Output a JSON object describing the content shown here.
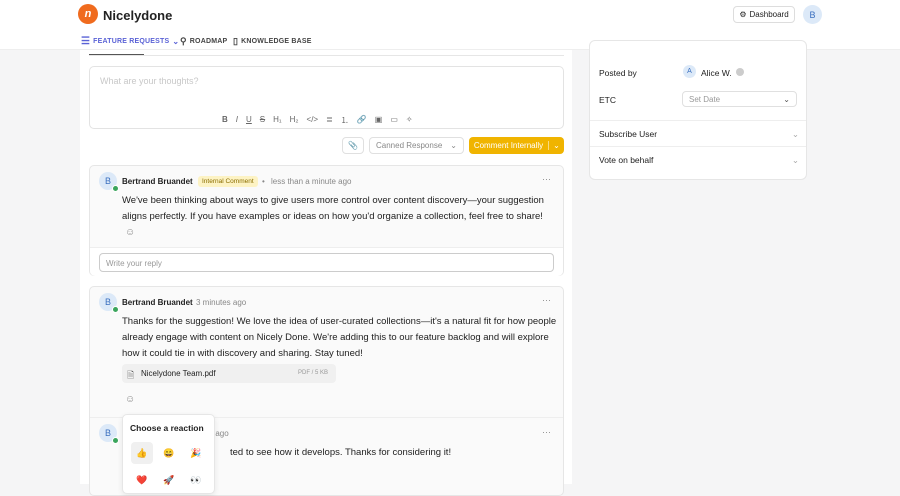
{
  "header": {
    "brand": "Nicelydone",
    "logo_letter": "n",
    "dashboard": "Dashboard",
    "user_initial": "B",
    "nav": [
      {
        "label": "FEATURE REQUESTS"
      },
      {
        "label": "ROADMAP"
      },
      {
        "label": "KNOWLEDGE BASE"
      }
    ]
  },
  "editor": {
    "placeholder": "What are your thoughts?",
    "toolbar": [
      "B",
      "I",
      "U",
      "S",
      "H₁",
      "H₂",
      "</>",
      "≣",
      "⒈",
      "🔗",
      "▣",
      "▭",
      "✧"
    ],
    "canned": "Canned Response",
    "submit": "Comment Internally"
  },
  "comments": [
    {
      "initial": "B",
      "author": "Bertrand Bruandet",
      "badge": "Internal Comment",
      "time": "less than a minute ago",
      "text": "We've been thinking about ways to give users more control over content discovery—your suggestion aligns perfectly. If you have examples or ideas on how you'd organize a collection, feel free to share!",
      "reply_placeholder": "Write your reply"
    },
    {
      "initial": "B",
      "author": "Bertrand Bruandet",
      "time": "3 minutes ago",
      "text": "Thanks for the suggestion! We love the idea of user-curated collections—it's a natural fit for how people already engage with content on Nicely Done. We're adding this to our feature backlog and will explore how it could tie in with discovery and sharing. Stay tuned!",
      "attachment": {
        "name": "Nicelydone Team.pdf",
        "meta": "PDF / 5 KB"
      }
    },
    {
      "initial": "B",
      "time": "ute ago",
      "text": "ted to see how it develops. Thanks for considering it!"
    }
  ],
  "reaction_popup": {
    "title": "Choose a reaction",
    "emojis": [
      "👍",
      "😄",
      "🎉",
      "❤️",
      "🚀",
      "👀"
    ]
  },
  "sidebar": {
    "posted_by_label": "Posted by",
    "poster_initial": "A",
    "poster": "Alice W.",
    "etc_label": "ETC",
    "etc_placeholder": "Set Date",
    "subscribe": "Subscribe User",
    "vote": "Vote on behalf"
  },
  "colors": {
    "accent": "#f0b400",
    "brand": "#f06b1e",
    "nav_active": "#5a62d6"
  }
}
